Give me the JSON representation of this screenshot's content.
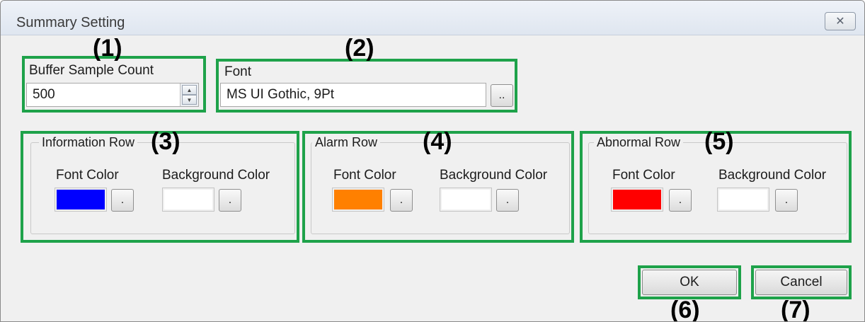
{
  "window": {
    "title": "Summary Setting",
    "close_glyph": "✕",
    "close_icon": "close-icon"
  },
  "annotations": [
    "(1)",
    "(2)",
    "(3)",
    "(4)",
    "(5)",
    "(6)",
    "(7)"
  ],
  "buffer": {
    "label": "Buffer Sample Count",
    "value": "500",
    "spin_up": "▲",
    "spin_down": "▼"
  },
  "font": {
    "label": "Font",
    "value": "MS UI Gothic, 9Pt",
    "browse": ".."
  },
  "groups": {
    "information": {
      "title": "Information Row",
      "font_color_label": "Font Color",
      "bg_color_label": "Background Color",
      "font_color": "#0000ff",
      "bg_color": "#ffffff",
      "browse": "."
    },
    "alarm": {
      "title": "Alarm Row",
      "font_color_label": "Font Color",
      "bg_color_label": "Background Color",
      "font_color": "#ff8000",
      "bg_color": "#ffffff",
      "browse": "."
    },
    "abnormal": {
      "title": "Abnormal Row",
      "font_color_label": "Font Color",
      "bg_color_label": "Background Color",
      "font_color": "#ff0000",
      "bg_color": "#ffffff",
      "browse": "."
    }
  },
  "buttons": {
    "ok": "OK",
    "cancel": "Cancel"
  },
  "colors": {
    "highlight": "#1ea24a"
  }
}
